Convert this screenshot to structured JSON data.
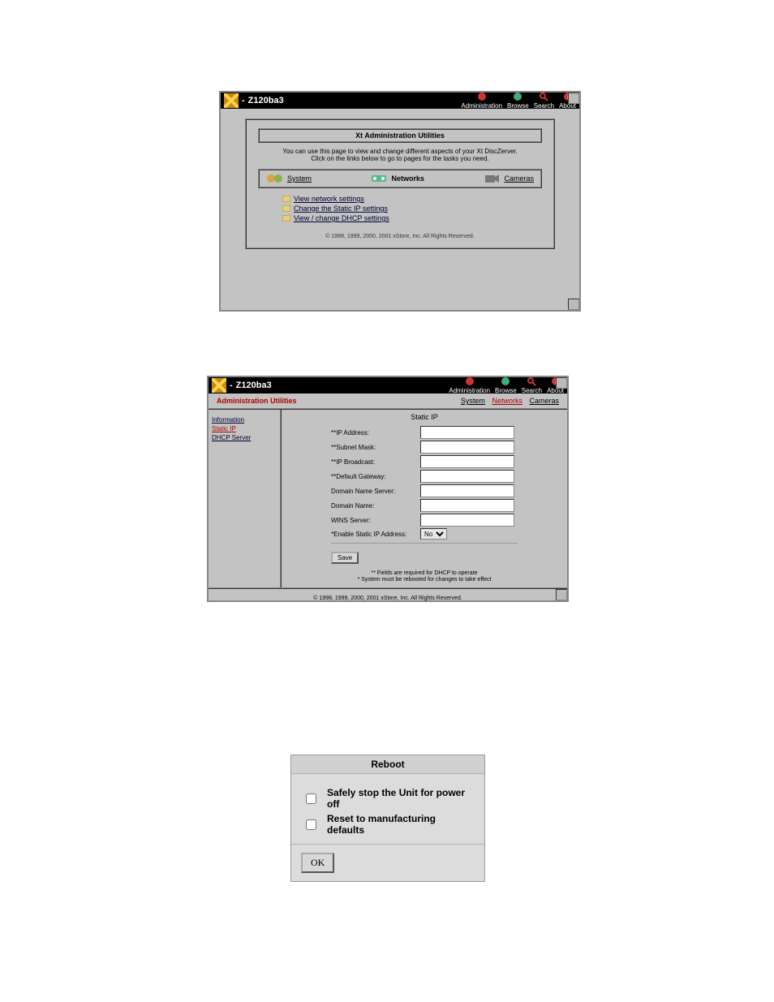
{
  "brand_title": "Z120ba3",
  "topnav": {
    "administration": "Administration",
    "browse": "Browse",
    "search": "Search",
    "about": "About"
  },
  "panel1": {
    "header": "Xt Administration Utilities",
    "desc1": "You can use this page to view and change different aspects of your Xt DiscZerver.",
    "desc2": "Click on the links below to go to pages for the tasks you need.",
    "cat_system": "System",
    "cat_networks": "Networks",
    "cat_cameras": "Cameras",
    "link1": "View network settings",
    "link2": "Change the Static IP settings",
    "link3": "View / change DHCP settings",
    "copyright": "© 1998, 1999, 2000, 2001 xStore, Inc. All Rights Reserved."
  },
  "panel2": {
    "adm_title": "Administration Utilities",
    "tab_system": "System",
    "tab_networks": "Networks",
    "tab_cameras": "Cameras",
    "side_info": "Information",
    "side_static": "Static IP",
    "side_dhcp": "DHCP Server",
    "main_header": "Static IP",
    "fields": {
      "ip": "**IP Address:",
      "subnet": "**Subnet Mask:",
      "broadcast": "**IP Broadcast:",
      "gateway": "**Default Gateway:",
      "dns": "Domain Name Server:",
      "domain": "Domain Name:",
      "wins": "WINS Server:",
      "enable": "*Enable Static IP Address:"
    },
    "enable_value": "No",
    "save_label": "Save",
    "note1": "** Fields are required for DHCP to operate",
    "note2": "* System must be rebooted for changes to take effect",
    "copyright": "© 1998, 1999, 2000, 2001 xStore, Inc. All Rights Reserved."
  },
  "panel3": {
    "header": "Reboot",
    "opt1": "Safely stop the Unit for power off",
    "opt2": "Reset to manufacturing defaults",
    "ok": "OK"
  }
}
